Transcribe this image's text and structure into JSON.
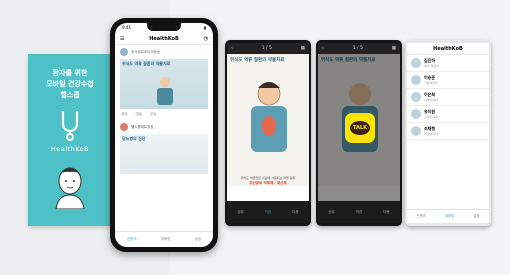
{
  "splash": {
    "line1": "환자를 위한",
    "line2": "모바일 건강수첩",
    "line3": "헬스콥",
    "brand": "HealthKoB"
  },
  "phone1": {
    "time": "9:41",
    "brand": "HealthKoB",
    "channel1": "의사공유오디서방송",
    "card_title": "위식도 역류 질환의 약물치료",
    "actions": [
      "공감",
      "댓글",
      "공유"
    ],
    "channel2": "헬스콥테트방송",
    "section": "당뇨병의 진단",
    "tabs": [
      "컨텐츠",
      "대화방",
      "설정"
    ]
  },
  "phone2": {
    "counter": "1 / 5",
    "title": "위식도 역류 질환의 약물치료",
    "caption": "위식도 역류질환 치료에 사용되는 약물 종류",
    "highlight": "위산분비 억제제 / 제산제",
    "footer": [
      "공유",
      "저장",
      "다음"
    ]
  },
  "phone3": {
    "talk": "TALK"
  },
  "phone4": {
    "brand": "HealthKoB",
    "contacts": [
      {
        "name": "김진하",
        "sub": "내과 전문의"
      },
      {
        "name": "이승준",
        "sub": "가정의학과"
      },
      {
        "name": "이은희",
        "sub": "내분비내과"
      },
      {
        "name": "유지원",
        "sub": "소화기내과"
      },
      {
        "name": "조재형",
        "sub": "가정의학과"
      }
    ],
    "tabs": [
      "컨텐츠",
      "대화방",
      "설정"
    ]
  }
}
